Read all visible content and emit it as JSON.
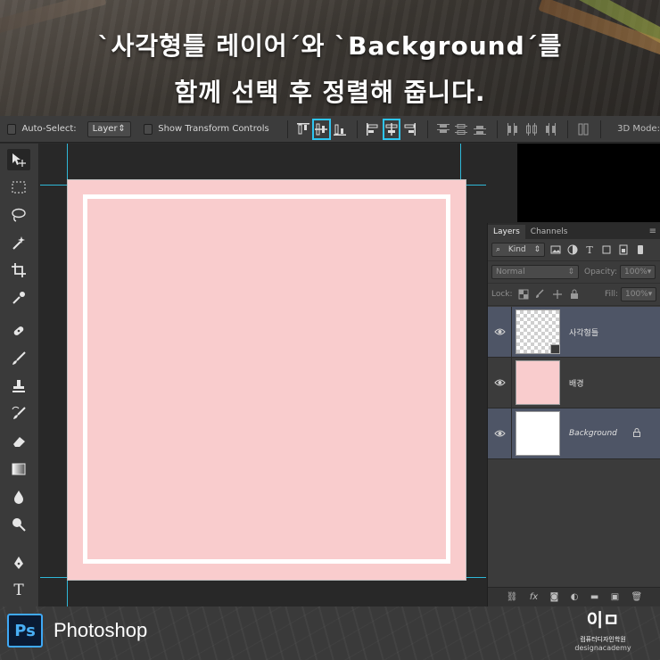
{
  "banner": {
    "line1": "`사각형틀 레이어´와 `Background´를",
    "line2": "함께 선택 후 정렬해 줍니다."
  },
  "options_bar": {
    "auto_select_label": "Auto-Select:",
    "auto_select_value": "Layer",
    "show_transform_label": "Show Transform Controls",
    "mode_3d_label": "3D Mode:",
    "highlight_color": "#2ec5f0"
  },
  "tools": [
    "move-tool",
    "marquee-tool",
    "lasso-tool",
    "magic-wand-tool",
    "crop-tool",
    "eyedropper-tool",
    "healing-brush-tool",
    "brush-tool",
    "clone-stamp-tool",
    "history-brush-tool",
    "eraser-tool",
    "gradient-tool",
    "blur-tool",
    "dodge-tool",
    "pen-tool",
    "type-tool"
  ],
  "type_tool_glyph": "T",
  "layers_panel": {
    "tabs": [
      "Layers",
      "Channels"
    ],
    "filter_kind": "Kind",
    "blend_mode": "Normal",
    "opacity_label": "Opacity:",
    "opacity_value": "100%",
    "lock_label": "Lock:",
    "fill_label": "Fill:",
    "fill_value": "100%",
    "layers": [
      {
        "name": "사각형틀",
        "thumb": "checker",
        "selected": true
      },
      {
        "name": "배경",
        "thumb": "pink",
        "selected": false
      },
      {
        "name": "Background",
        "thumb": "white",
        "selected": true,
        "locked": true
      }
    ],
    "footer_fx": "fx"
  },
  "document": {
    "background_color": "#f9cccd",
    "frame_color": "#ffffff"
  },
  "footer": {
    "ps_logo": "Ps",
    "app_name": "Photoshop",
    "academy_mark": "이ㅁ",
    "academy_ko": "컴퓨터디자인학원",
    "academy_en": "designacademy"
  }
}
